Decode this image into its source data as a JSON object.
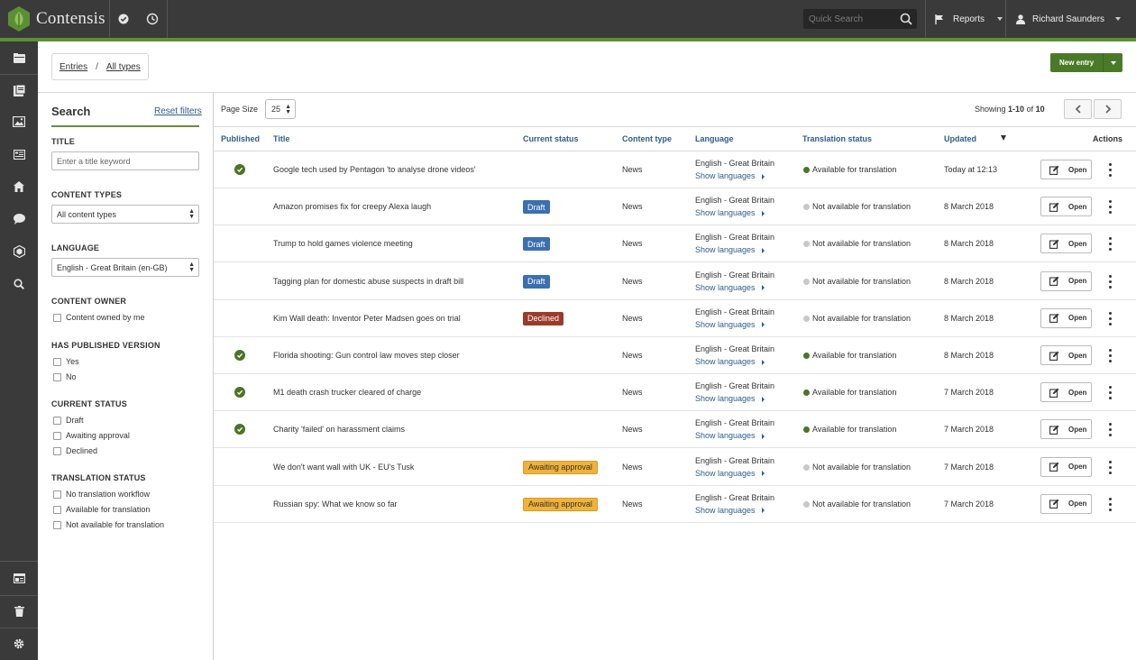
{
  "app": {
    "name": "Contensis"
  },
  "topbar": {
    "search_placeholder": "Quick Search",
    "reports_label": "Reports",
    "user_name": "Richard Saunders"
  },
  "breadcrumb": {
    "entries": "Entries",
    "separator": "/",
    "all_types": "All types"
  },
  "header": {
    "new_entry_label": "New entry"
  },
  "filters": {
    "title": "Search",
    "reset_label": "Reset filters",
    "title_heading": "TITLE",
    "title_placeholder": "Enter a title keyword",
    "content_types_heading": "CONTENT TYPES",
    "content_types_value": "All content types",
    "language_heading": "LANGUAGE",
    "language_value": "English - Great Britain (en-GB)",
    "owner_heading": "CONTENT OWNER",
    "owner_option": "Content owned by me",
    "published_heading": "HAS PUBLISHED VERSION",
    "published_yes": "Yes",
    "published_no": "No",
    "status_heading": "CURRENT STATUS",
    "status_draft": "Draft",
    "status_awaiting": "Awaiting approval",
    "status_declined": "Declined",
    "translation_heading": "TRANSLATION STATUS",
    "translation_none": "No translation workflow",
    "translation_available": "Available for translation",
    "translation_not_available": "Not available for translation"
  },
  "list": {
    "page_size_label": "Page Size",
    "page_size_value": "25",
    "showing_prefix": "Showing",
    "showing_range": "1-10",
    "showing_of": "of",
    "showing_total": "10",
    "columns": {
      "published": "Published",
      "title": "Title",
      "current_status": "Current status",
      "content_type": "Content type",
      "language": "Language",
      "translation_status": "Translation status",
      "updated": "Updated",
      "actions": "Actions"
    },
    "open_label": "Open",
    "show_languages_label": "Show languages",
    "rows": [
      {
        "published": true,
        "title": "Google tech used by Pentagon 'to analyse drone videos'",
        "status": "",
        "content_type": "News",
        "language": "English - Great Britain",
        "translation": "Available for translation",
        "translation_available": true,
        "updated": "Today at 12:13"
      },
      {
        "published": false,
        "title": "Amazon promises fix for creepy Alexa laugh",
        "status": "Draft",
        "content_type": "News",
        "language": "English - Great Britain",
        "translation": "Not available for translation",
        "translation_available": false,
        "updated": "8 March 2018"
      },
      {
        "published": false,
        "title": "Trump to hold games violence meeting",
        "status": "Draft",
        "content_type": "News",
        "language": "English - Great Britain",
        "translation": "Not available for translation",
        "translation_available": false,
        "updated": "8 March 2018"
      },
      {
        "published": false,
        "title": "Tagging plan for domestic abuse suspects in draft bill",
        "status": "Draft",
        "content_type": "News",
        "language": "English - Great Britain",
        "translation": "Not available for translation",
        "translation_available": false,
        "updated": "8 March 2018"
      },
      {
        "published": false,
        "title": "Kim Wall death: Inventor Peter Madsen goes on trial",
        "status": "Declined",
        "content_type": "News",
        "language": "English - Great Britain",
        "translation": "Not available for translation",
        "translation_available": false,
        "updated": "8 March 2018"
      },
      {
        "published": true,
        "title": "Florida shooting: Gun control law moves step closer",
        "status": "",
        "content_type": "News",
        "language": "English - Great Britain",
        "translation": "Available for translation",
        "translation_available": true,
        "updated": "8 March 2018"
      },
      {
        "published": true,
        "title": "M1 death crash trucker cleared of charge",
        "status": "",
        "content_type": "News",
        "language": "English - Great Britain",
        "translation": "Available for translation",
        "translation_available": true,
        "updated": "7 March 2018"
      },
      {
        "published": true,
        "title": "Charity 'failed' on harassment claims",
        "status": "",
        "content_type": "News",
        "language": "English - Great Britain",
        "translation": "Available for translation",
        "translation_available": true,
        "updated": "7 March 2018"
      },
      {
        "published": false,
        "title": "We don't want wall with UK - EU's Tusk",
        "status": "Awaiting approval",
        "content_type": "News",
        "language": "English - Great Britain",
        "translation": "Not available for translation",
        "translation_available": false,
        "updated": "7 March 2018"
      },
      {
        "published": false,
        "title": "Russian spy: What we know so far",
        "status": "Awaiting approval",
        "content_type": "News",
        "language": "English - Great Britain",
        "translation": "Not available for translation",
        "translation_available": false,
        "updated": "7 March 2018"
      }
    ]
  },
  "colors": {
    "accent_green": "#5c8f34",
    "draft": "#3b6fb0",
    "declined": "#9c3a2a",
    "awaiting": "#f0b23a",
    "available_dot": "#4b7427",
    "not_available_dot": "#c8c8c8",
    "link": "#2f5d88"
  },
  "icons": {
    "sidebar": [
      "folder-icon",
      "entries-icon",
      "image-icon",
      "list-icon",
      "home-icon",
      "comment-icon",
      "cube-icon",
      "search-icon",
      "window-icon",
      "trash-icon",
      "gear-icon"
    ],
    "topbar": [
      "check-circle-icon",
      "history-icon",
      "search-icon",
      "flag-icon",
      "user-icon"
    ]
  }
}
